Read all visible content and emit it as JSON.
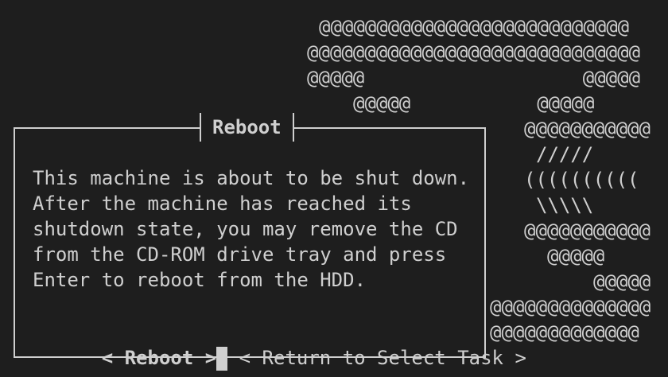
{
  "art": [
    "@@@@@@@@@@@@@@@@@@@@@@@@@@@",
    "@@@@@@@@@@@@@@@@@@@@@@@@@@@@@",
    "@@@@@                   @@@@@",
    "@@@@@           @@@@@",
    "@@@@@@@@@@@",
    "/////",
    "((((((((((",
    "\\\\\\\\\\",
    "@@@@@@@@@@@",
    "@@@@@",
    "@@@@@",
    "@@@@@@@@@@@@@@",
    "@@@@@@@@@@@@@"
  ],
  "dialog": {
    "title": "Reboot",
    "message_lines": [
      "This machine is about to be shut down.",
      "After the machine has reached its",
      "shutdown state, you may remove the CD",
      "from the CD-ROM drive tray and press",
      "Enter to reboot from the HDD."
    ],
    "reboot_button": "< Reboot >",
    "return_button": "< Return to Select Task >"
  }
}
